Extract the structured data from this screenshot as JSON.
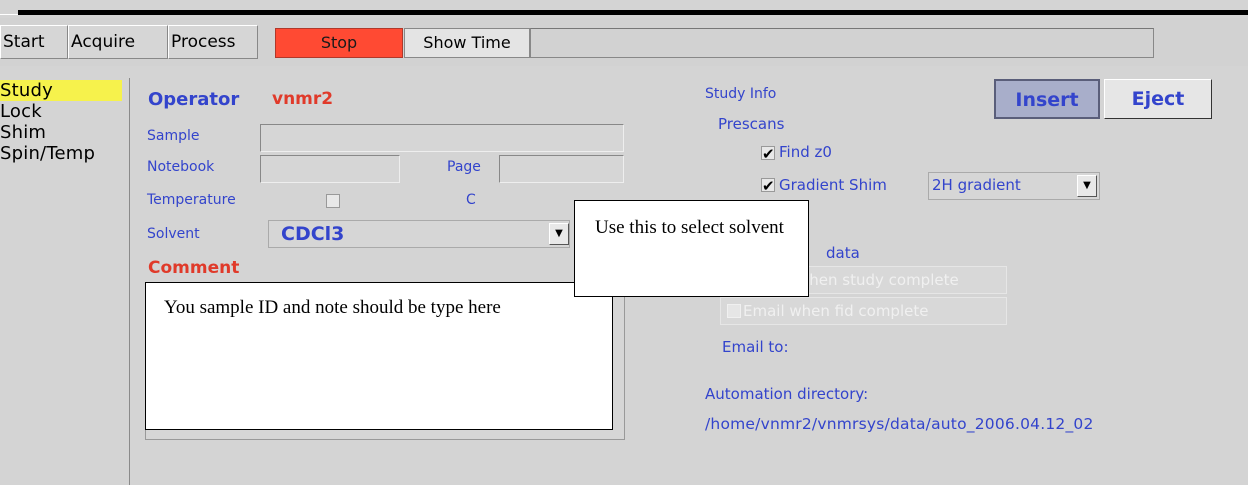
{
  "tabs": [
    "Start",
    "Acquire",
    "Process"
  ],
  "toolbar": {
    "stop_label": "Stop",
    "show_time_label": "Show Time"
  },
  "sidebar": {
    "items": [
      "Study",
      "Lock",
      "Shim",
      "Spin/Temp"
    ],
    "selected": "Study"
  },
  "form": {
    "operator_label": "Operator",
    "operator_value": "vnmr2",
    "sample_label": "Sample",
    "sample_value": "",
    "notebook_label": "Notebook",
    "notebook_value": "",
    "page_label": "Page",
    "page_value": "",
    "temperature_label": "Temperature",
    "temperature_unit": "C",
    "solvent_label": "Solvent",
    "solvent_value": "CDCl3",
    "comment_label": "Comment"
  },
  "study_info": {
    "title": "Study Info",
    "prescans_label": "Prescans",
    "find_z0_label": "Find z0",
    "find_z0_checked": true,
    "gradient_shim_label": "Gradient Shim",
    "gradient_shim_checked": true,
    "gradient_option": "2H gradient",
    "data_label": "data",
    "email_study_label": "when study complete",
    "email_fid_label": "Email when fid complete",
    "email_to_label": "Email to:",
    "automation_dir_label": "Automation directory:",
    "automation_dir_value": "/home/vnmr2/vnmrsys/data/auto_2006.04.12_02"
  },
  "buttons": {
    "insert": "Insert",
    "eject": "Eject"
  },
  "callouts": {
    "solvent_note": "Use this to select solvent",
    "comment_note": "You sample ID and note  should be type here"
  },
  "colors": {
    "accent_blue": "#3344cc",
    "accent_red": "#e03a2a",
    "stop_red": "#ff4a33",
    "selection_yellow": "#f6f24c",
    "background": "#d4d4d4"
  }
}
